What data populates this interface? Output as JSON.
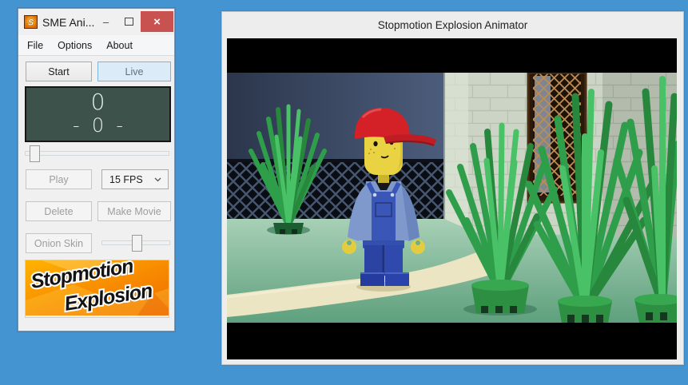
{
  "left_window": {
    "title": "SME Ani...",
    "window_controls": {
      "minimize_glyph": "–",
      "close_glyph": "×"
    },
    "menu": [
      {
        "label": "File"
      },
      {
        "label": "Options"
      },
      {
        "label": "About"
      }
    ],
    "transport": {
      "start": "Start",
      "live": "Live"
    },
    "counter": {
      "frame": "0",
      "display": "-  0  -"
    },
    "playback": {
      "play": "Play",
      "fps_value": "15 FPS"
    },
    "edit": {
      "delete": "Delete",
      "make_movie": "Make Movie"
    },
    "onion": {
      "onion_skin": "Onion Skin"
    },
    "logo": {
      "line1": "Stopmotion",
      "line2": "Explosion"
    }
  },
  "right_window": {
    "title": "Stopmotion Explosion Animator"
  },
  "colors": {
    "desktop_blue": "#4494d1",
    "close_button_red": "#c85250",
    "counter_bg": "#3e524c",
    "counter_text": "#e6eeeb",
    "live_button_fill": "#dcebf8",
    "live_button_border": "#7fb2de",
    "logo_orange": "#f78a00",
    "bush_green": "#2f9e4a",
    "ground_green": "#6fae8c",
    "path_cream": "#ece5c4",
    "wall_navy": "#39455e",
    "brick_light": "#ccd5c5",
    "cap_red": "#d42127",
    "minifig_yellow": "#e9d342",
    "overall_blue": "#3a57b8"
  }
}
